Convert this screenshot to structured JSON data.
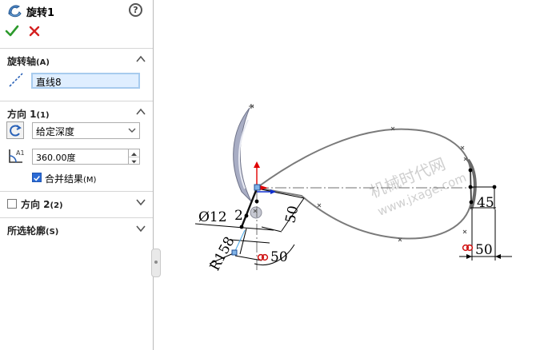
{
  "feature": {
    "title": "旋转1",
    "help_glyph": "?"
  },
  "panel": {
    "axis_section": {
      "title": "旋转轴",
      "shortcut": "(A)",
      "axis_value": "直线8"
    },
    "direction1": {
      "title": "方向 1",
      "shortcut": "(1)",
      "end_condition": "给定深度",
      "angle": "360.00度",
      "merge_label": "合并结果",
      "merge_shortcut": "(M)",
      "merge_checked": true
    },
    "direction2": {
      "title": "方向 2",
      "shortcut": "(2)",
      "checked": false
    },
    "contours": {
      "title": "所选轮廓",
      "shortcut": "(S)"
    }
  },
  "sketch": {
    "dimensions": {
      "diameter": "Ø12",
      "small_value": "2",
      "radius": "R158",
      "angle_left": "50",
      "vertical_left": "50",
      "vertical_right": "45",
      "horizontal_right": "50"
    },
    "colors": {
      "curve": "#7a7a7a",
      "axis": "#6f6f6f",
      "point": "#000000",
      "relation": "#d01010",
      "y_axis": "#e00000",
      "x_axis": "#1030d0"
    }
  },
  "watermark": {
    "line1": "机械时代网",
    "line2": "www.jxage.com"
  }
}
